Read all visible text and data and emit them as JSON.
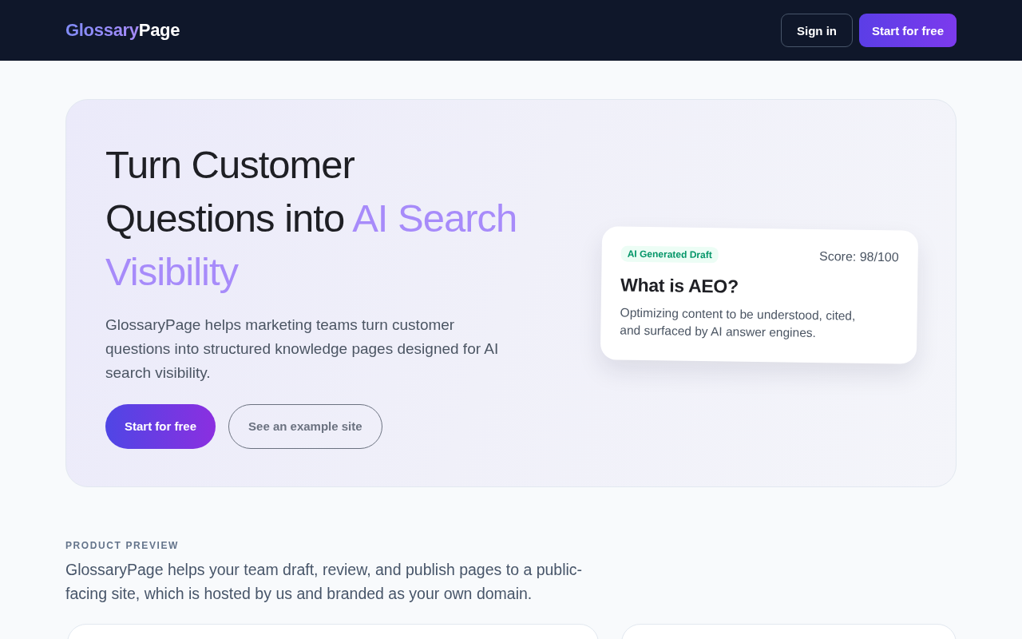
{
  "header": {
    "logo": {
      "primary": "Glossary",
      "secondary": "Page"
    },
    "buttons": [
      {
        "label": "Sign in",
        "kind": "outline"
      },
      {
        "label": "Start for free",
        "kind": "primary"
      }
    ]
  },
  "hero": {
    "heading": "Turn Customer Questions into ",
    "heading_highlight": "AI Search Visibility",
    "description": "GlossaryPage helps marketing teams turn customer questions into structured knowledge pages designed for AI search visibility.",
    "buttons": [
      {
        "label": "Start for free",
        "kind": "primary"
      },
      {
        "label": "See an example site",
        "kind": "outline"
      }
    ],
    "preview_card": {
      "badge": "AI Generated Draft",
      "score": "Score: 98/100",
      "title": "What is AEO?",
      "description": "Optimizing content to be understood, cited, and surfaced by AI answer engines."
    }
  },
  "product_preview": {
    "eyebrow": "PRODUCT PREVIEW",
    "description": "GlossaryPage helps your team draft, review, and publish pages to a public-facing site, which is hosted by us and branded as your own domain.",
    "cards": [
      {
        "kind": "wide"
      },
      {
        "kind": "narrow"
      }
    ]
  }
}
